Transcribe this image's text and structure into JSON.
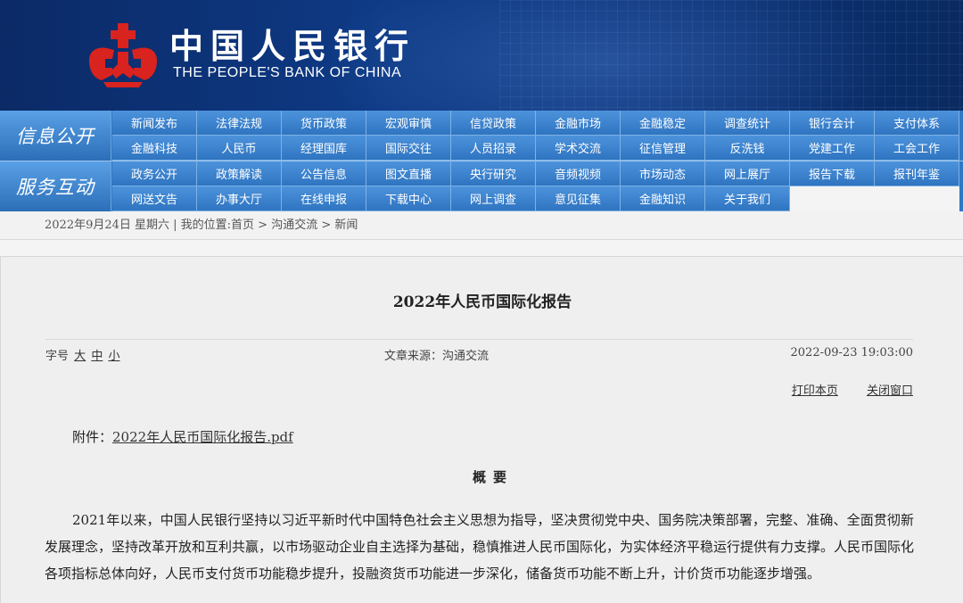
{
  "header": {
    "logo_cn": "中国人民银行",
    "logo_en": "THE PEOPLE'S BANK OF CHINA",
    "brand_red": "#d9231f",
    "brand_blue": "#0e3a86"
  },
  "nav": {
    "section1_label": "信息公开",
    "section2_label": "服务互动",
    "row1": [
      "新闻发布",
      "法律法规",
      "货币政策",
      "宏观审慎",
      "信贷政策",
      "金融市场",
      "金融稳定",
      "调查统计",
      "银行会计",
      "支付体系",
      "金融科技",
      "人民币",
      "经理国库",
      "国际交往",
      "人员招录",
      "学术交流",
      "征信管理",
      "反洗钱",
      "党建工作",
      "工会工作"
    ],
    "row2": [
      "政务公开",
      "政策解读",
      "公告信息",
      "图文直播",
      "央行研究",
      "音频视频",
      "市场动态",
      "网上展厅",
      "报告下载",
      "报刊年鉴",
      "网送文告",
      "办事大厅",
      "在线申报",
      "下载中心",
      "网上调查",
      "意见征集",
      "金融知识",
      "关于我们"
    ]
  },
  "breadcrumb": "2022年9月24日 星期六 | 我的位置:首页 > 沟通交流 > 新闻",
  "article": {
    "title": "2022年人民币国际化报告",
    "font_label": "字号",
    "font_large": "大",
    "font_medium": "中",
    "font_small": "小",
    "source": "文章来源：沟通交流",
    "datetime": "2022-09-23 19:03:00",
    "print_label": "打印本页",
    "close_label": "关闭窗口",
    "attachment_label": "附件：",
    "attachment_file": "2022年人民币国际化报告.pdf",
    "summary_heading": "概要",
    "paragraph": "2021年以来，中国人民银行坚持以习近平新时代中国特色社会主义思想为指导，坚决贯彻党中央、国务院决策部署，完整、准确、全面贯彻新发展理念，坚持改革开放和互利共赢，以市场驱动企业自主选择为基础，稳慎推进人民币国际化，为实体经济平稳运行提供有力支撑。人民币国际化各项指标总体向好，人民币支付货币功能稳步提升，投融资货币功能进一步深化，储备货币功能不断上升，计价货币功能逐步增强。"
  }
}
